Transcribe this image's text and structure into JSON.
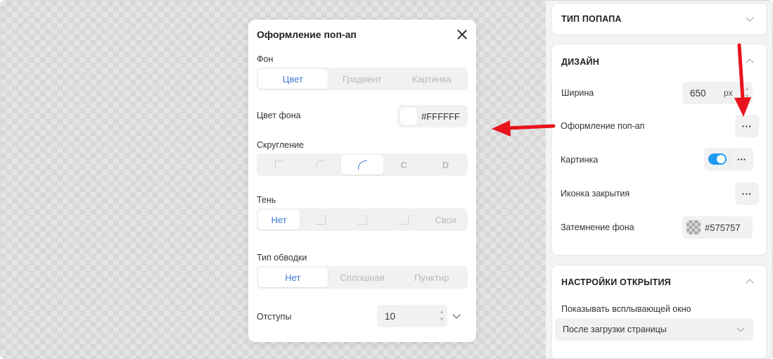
{
  "modal": {
    "title": "Оформление поп-ап",
    "background": {
      "label": "Фон",
      "options": [
        "Цвет",
        "Градиент",
        "Картинка"
      ],
      "selected": "Цвет"
    },
    "bg_color": {
      "label": "Цвет фона",
      "value": "#FFFFFF"
    },
    "rounding": {
      "label": "Скругление",
      "letters": [
        "C",
        "D"
      ]
    },
    "shadow": {
      "label": "Тень",
      "none_label": "Нет",
      "custom_label": "Своя"
    },
    "stroke": {
      "label": "Тип обводки",
      "options": [
        "Нет",
        "Сплошная",
        "Пунктир"
      ],
      "selected": "Нет"
    },
    "padding": {
      "label": "Отступы",
      "value": "10"
    }
  },
  "panel": {
    "popup_type": {
      "title": "ТИП ПОПАПА"
    },
    "design": {
      "title": "ДИЗАЙН",
      "width_label": "Ширина",
      "width_value": "650",
      "width_unit": "px",
      "popup_style_label": "Оформление поп-ап",
      "image_label": "Картинка",
      "image_enabled": true,
      "close_icon_label": "Иконка закрытия",
      "overlay_label": "Затемнение фона",
      "overlay_value": "#575757",
      "dots": "···"
    },
    "open_settings": {
      "title": "НАСТРОЙКИ ОТКРЫТИЯ",
      "show_label": "Показывать всплывающей окно",
      "show_value": "После загрузки страницы"
    }
  },
  "colors": {
    "accent": "#3a7bd5",
    "toggle": "#1e9bf0",
    "arrow": "#e8141c"
  }
}
